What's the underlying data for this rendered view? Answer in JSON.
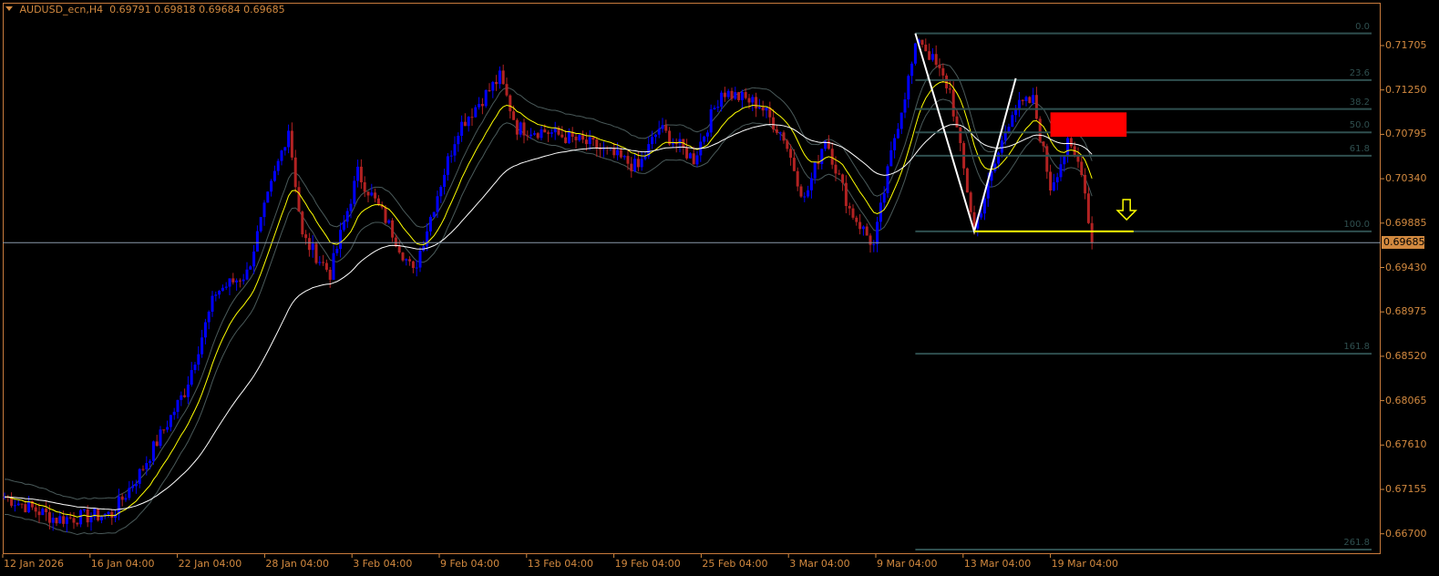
{
  "header": {
    "symbol": "AUDUSD_ecn,H4",
    "open": "0.69791",
    "high": "0.69818",
    "low": "0.69684",
    "close": "0.69685"
  },
  "colors": {
    "axis": "#d2893f",
    "bull": "#0000ff",
    "bear": "#b22222",
    "ma_fast": "#ffff00",
    "ma_slow": "#ffffff",
    "bands": "#4a5a5a",
    "fib": "#2f4f4f",
    "zone": "#ff0000",
    "arrow": "#ffff00"
  },
  "chart_data": {
    "type": "candlestick",
    "title": "AUDUSD_ecn,H4",
    "ylim": [
      0.6651,
      0.7191
    ],
    "y_ticks": [
      "0.71705",
      "0.71250",
      "0.70795",
      "0.70340",
      "0.69885",
      "0.69430",
      "0.68975",
      "0.68520",
      "0.68065",
      "0.67610",
      "0.67155",
      "0.66700"
    ],
    "current_price": "0.69685",
    "x_ticks": [
      "12 Jan 2026",
      "16 Jan 04:00",
      "22 Jan 04:00",
      "28 Jan 04:00",
      "3 Feb 04:00",
      "9 Feb 04:00",
      "13 Feb 04:00",
      "19 Feb 04:00",
      "25 Feb 04:00",
      "3 Mar 04:00",
      "9 Mar 04:00",
      "13 Mar 04:00",
      "19 Mar 04:00"
    ],
    "bars_total": 315,
    "close_waypoints": [
      [
        0,
        0.6708
      ],
      [
        15,
        0.6685
      ],
      [
        31,
        0.669
      ],
      [
        39,
        0.6732
      ],
      [
        52,
        0.6816
      ],
      [
        61,
        0.6918
      ],
      [
        70,
        0.6937
      ],
      [
        75,
        0.7002
      ],
      [
        82,
        0.7086
      ],
      [
        86,
        0.6974
      ],
      [
        94,
        0.6937
      ],
      [
        102,
        0.704
      ],
      [
        110,
        0.6993
      ],
      [
        118,
        0.6937
      ],
      [
        126,
        0.703
      ],
      [
        131,
        0.7086
      ],
      [
        143,
        0.7138
      ],
      [
        148,
        0.7086
      ],
      [
        157,
        0.7082
      ],
      [
        170,
        0.7068
      ],
      [
        183,
        0.7045
      ],
      [
        189,
        0.7086
      ],
      [
        199,
        0.7054
      ],
      [
        207,
        0.7124
      ],
      [
        218,
        0.711
      ],
      [
        225,
        0.7077
      ],
      [
        231,
        0.7012
      ],
      [
        237,
        0.7077
      ],
      [
        244,
        0.7003
      ],
      [
        251,
        0.6965
      ],
      [
        257,
        0.7077
      ],
      [
        264,
        0.718
      ],
      [
        273,
        0.7124
      ],
      [
        280,
        0.6982
      ],
      [
        291,
        0.7105
      ],
      [
        297,
        0.7114
      ],
      [
        302,
        0.7026
      ],
      [
        307,
        0.7068
      ],
      [
        311,
        0.7045
      ],
      [
        314,
        0.69685
      ]
    ],
    "fibonacci": {
      "high": 0.7183,
      "low": 0.698,
      "levels": [
        "0.0",
        "23.6",
        "38.2",
        "50.0",
        "61.8",
        "100.0",
        "161.8",
        "261.8"
      ],
      "ratios": [
        0,
        0.236,
        0.382,
        0.5,
        0.618,
        1.0,
        1.618,
        2.618
      ],
      "start_bar": 263
    },
    "zigzag": [
      [
        263,
        0.7183
      ],
      [
        280,
        0.698
      ],
      [
        292,
        0.7137
      ]
    ],
    "support_line": {
      "price": 0.698,
      "from_bar": 280,
      "to_bar": 326
    },
    "resistance_zone": {
      "from_bar": 302,
      "to_bar": 324,
      "top": 0.7102,
      "bottom": 0.7077
    },
    "arrow": {
      "direction": "down",
      "bar": 324,
      "price": 0.6992
    }
  }
}
